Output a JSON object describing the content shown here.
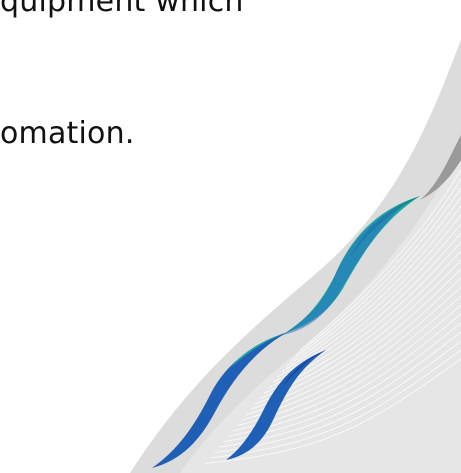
{
  "slide": {
    "body_lines": [
      "quipment  which",
      "omation."
    ]
  },
  "colors": {
    "background": "#ffffff",
    "swoosh_light": "#dcdcdc",
    "swoosh_mid": "#c8c8c8",
    "swoosh_grey": "#9a9a9a",
    "teal": "#1ea7a2",
    "teal_dark": "#0f8c8a",
    "blue": "#1f5fb5",
    "blue_dark": "#123f91",
    "blue_mid": "#2d6fc4"
  },
  "graphics": {
    "decoration": "abstract-swoosh-logo-mark"
  }
}
